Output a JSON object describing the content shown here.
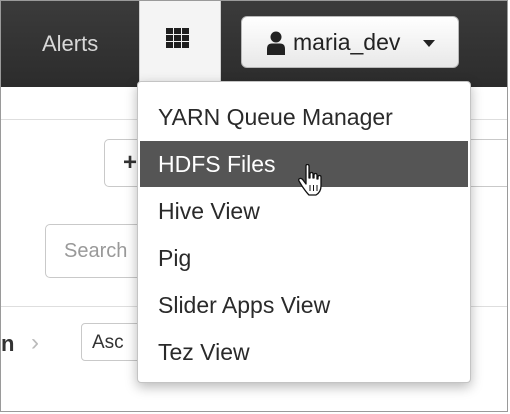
{
  "navbar": {
    "alerts_label": "Alerts",
    "views_icon": "grid-icon",
    "user": {
      "icon": "user-icon",
      "name": "maria_dev",
      "caret_icon": "caret-down-icon"
    }
  },
  "dropdown": {
    "items": [
      {
        "label": "YARN Queue Manager",
        "active": false
      },
      {
        "label": "HDFS Files",
        "active": true
      },
      {
        "label": "Hive View",
        "active": false
      },
      {
        "label": "Pig",
        "active": false
      },
      {
        "label": "Slider Apps View",
        "active": false
      },
      {
        "label": "Tez View",
        "active": false
      }
    ]
  },
  "background": {
    "plus_label": "+",
    "search_placeholder": "Search",
    "crumb_label": "n",
    "crumb_arrow": "›",
    "sort_label": "Asc"
  },
  "colors": {
    "navbar": "#2f2f2f",
    "active_item": "#555555",
    "text": "#2a2a2a"
  }
}
